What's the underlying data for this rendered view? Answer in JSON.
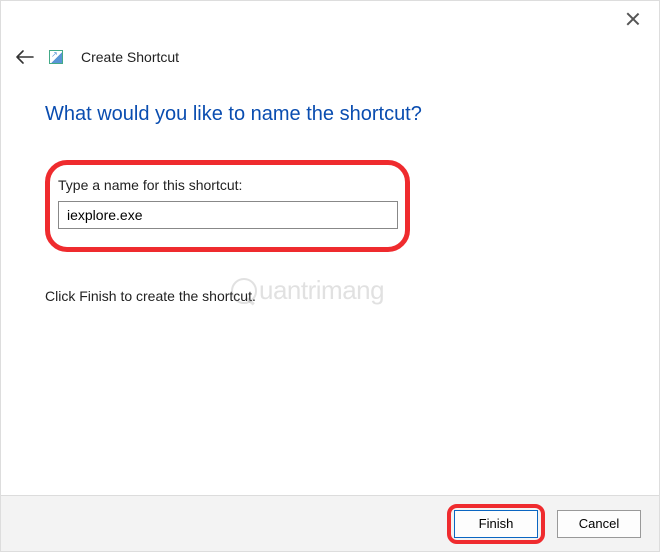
{
  "window": {
    "title": "Create Shortcut"
  },
  "heading": "What would you like to name the shortcut?",
  "input": {
    "label": "Type a name for this shortcut:",
    "value": "iexplore.exe"
  },
  "instruction": "Click Finish to create the shortcut.",
  "watermark": "uantrimang",
  "buttons": {
    "finish": "Finish",
    "cancel": "Cancel"
  }
}
